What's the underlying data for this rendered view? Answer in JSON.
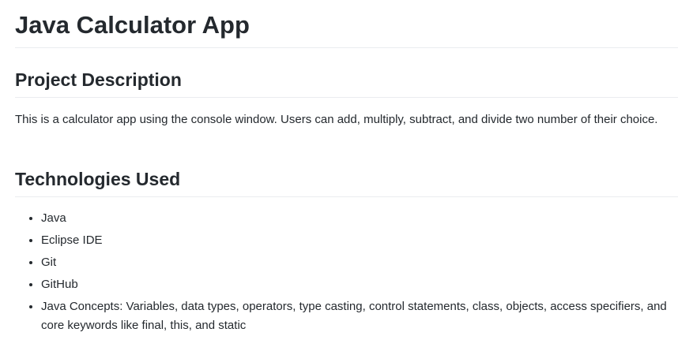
{
  "title": "Java Calculator App",
  "sections": [
    {
      "heading": "Project Description",
      "text": "This is a calculator app using the console window. Users can add, multiply, subtract, and divide two number of their choice."
    },
    {
      "heading": "Technologies Used",
      "items": [
        "Java",
        "Eclipse IDE",
        "Git",
        "GitHub",
        "Java Concepts: Variables, data types, operators, type casting, control statements, class, objects, access specifiers, and core keywords like final, this, and static"
      ]
    }
  ]
}
